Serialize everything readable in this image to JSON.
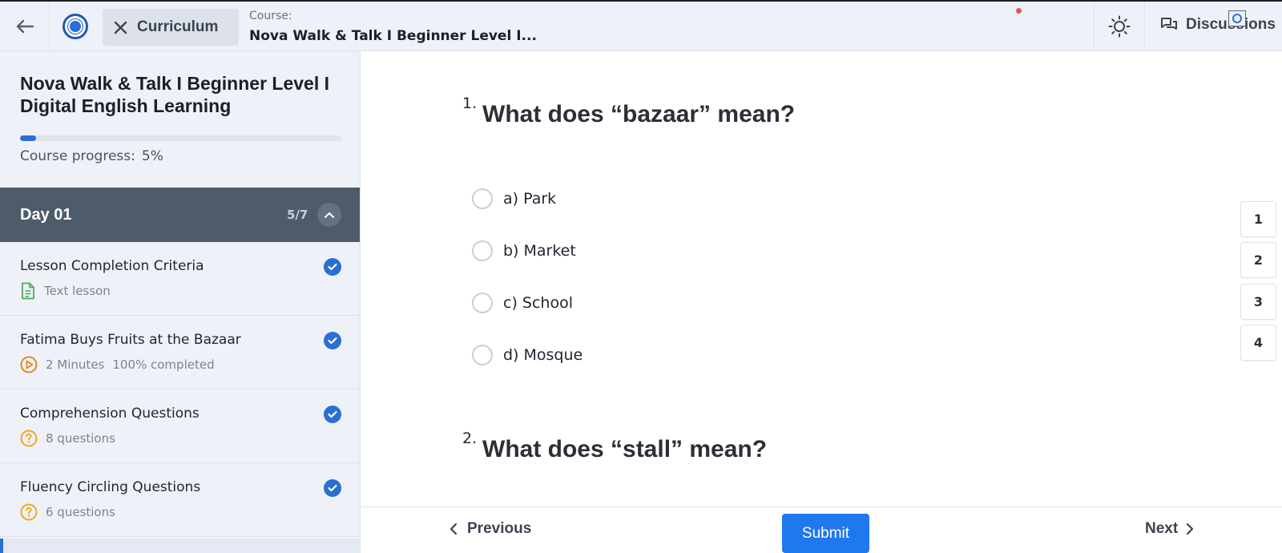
{
  "topbar": {
    "back_icon": "arrow-left-icon",
    "logo_icon": "school-logo-icon",
    "curriculum_label": "Curriculum",
    "course_small_label": "Course:",
    "course_name": "Nova Walk & Talk I Beginner Level I...",
    "theme_icon": "sun-icon",
    "discussions_label": "Discussions",
    "discussions_icon": "chat-bubbles-icon"
  },
  "sidebar": {
    "course_title": "Nova Walk & Talk I Beginner Level I Digital English Learning",
    "progress_label": "Course progress:",
    "progress_value": "5%",
    "progress_fraction": 0.05,
    "section": {
      "title": "Day 01",
      "count": "5/7"
    },
    "lessons": [
      {
        "title": "Lesson Completion Criteria",
        "meta1": "Text lesson",
        "meta2": "",
        "icon": "document-icon",
        "completed": true
      },
      {
        "title": "Fatima Buys Fruits at the Bazaar",
        "meta1": "2 Minutes",
        "meta2": "100% completed",
        "icon": "play-circle-icon",
        "completed": true
      },
      {
        "title": "Comprehension Questions",
        "meta1": "8 questions",
        "meta2": "",
        "icon": "question-circle-icon",
        "completed": true
      },
      {
        "title": "Fluency Circling Questions",
        "meta1": "6 questions",
        "meta2": "",
        "icon": "question-circle-icon",
        "completed": true
      }
    ]
  },
  "quiz": {
    "questions": [
      {
        "number": "1.",
        "text": "What does “bazaar” mean?",
        "options": [
          "a) Park",
          "b) Market",
          "c) School",
          "d) Mosque"
        ]
      },
      {
        "number": "2.",
        "text": "What does “stall” mean?"
      }
    ],
    "question_nav": [
      "1",
      "2",
      "3",
      "4"
    ]
  },
  "footer": {
    "previous_label": "Previous",
    "submit_label": "Submit",
    "next_label": "Next"
  },
  "colors": {
    "accent": "#2a6fd1",
    "submit": "#1f78ee",
    "section_header": "#4e5b6b",
    "sidebar_bg": "#eef1f8",
    "text_lesson_icon": "#4caf50",
    "video_icon": "#e28a1c",
    "quiz_icon": "#f0a818"
  }
}
